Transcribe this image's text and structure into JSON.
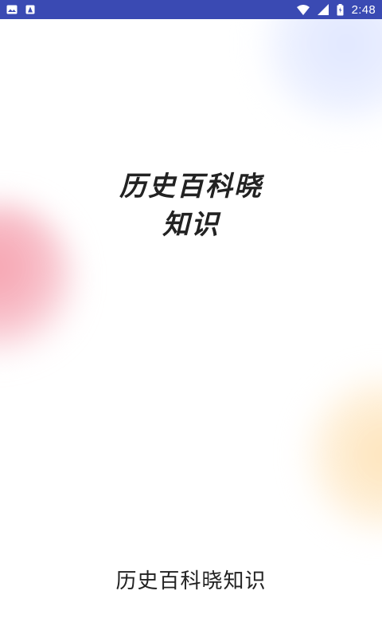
{
  "status_bar": {
    "time": "2:48",
    "left_icons": [
      "image-icon",
      "notification-app-icon"
    ],
    "right_icons": [
      "wifi-icon",
      "signal-icon",
      "battery-icon"
    ],
    "background": "#3a4ab3"
  },
  "splash": {
    "title_line1": "历史百科晓",
    "title_line2": "知识",
    "app_name": "历史百科晓知识"
  },
  "colors": {
    "background": "#ffffff",
    "text": "#222222",
    "blob_blue": "#e4ebff",
    "blob_pink": "#f6a0ad",
    "blob_orange": "#fde3b8"
  }
}
